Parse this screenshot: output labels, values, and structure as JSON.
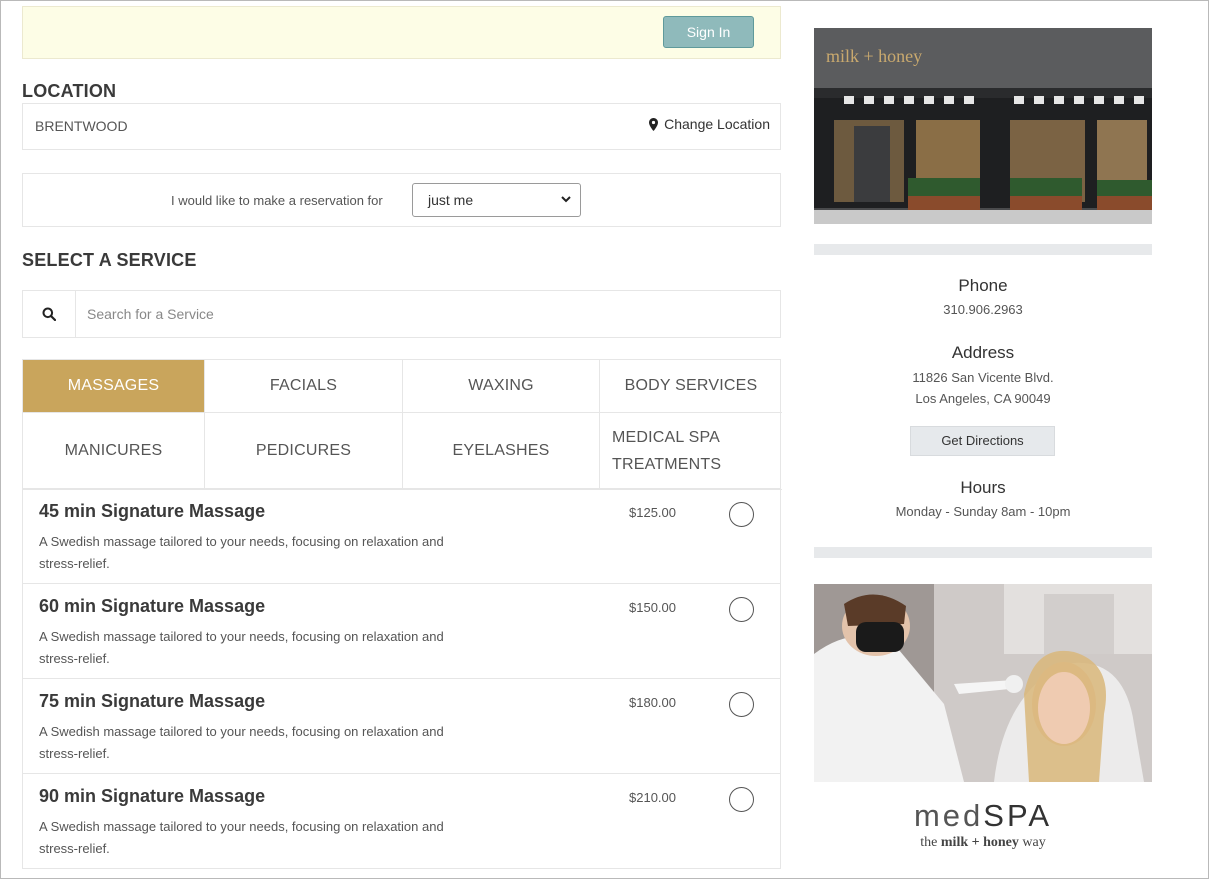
{
  "header": {
    "signin_label": "Sign In"
  },
  "location": {
    "title": "LOCATION",
    "name": "BRENTWOOD",
    "change_label": "Change Location"
  },
  "reservation": {
    "label": "I would like to make a reservation for",
    "selected": "just me"
  },
  "service": {
    "title": "SELECT A SERVICE",
    "search_placeholder": "Search for a Service"
  },
  "tabs": [
    {
      "label": "MASSAGES",
      "active": true
    },
    {
      "label": "FACIALS"
    },
    {
      "label": "WAXING"
    },
    {
      "label": "BODY SERVICES"
    },
    {
      "label": "MANICURES"
    },
    {
      "label": "PEDICURES"
    },
    {
      "label": "EYELASHES"
    },
    {
      "label": "MEDICAL SPA TREATMENTS",
      "line1": "MEDICAL SPA",
      "line2": "TREATMENTS"
    }
  ],
  "services": [
    {
      "name": "45 min Signature Massage",
      "desc": "A Swedish massage tailored to your needs, focusing on relaxation and stress-relief.",
      "price": "$125.00"
    },
    {
      "name": "60 min Signature Massage",
      "desc": "A Swedish massage tailored to your needs, focusing on relaxation and stress-relief.",
      "price": "$150.00"
    },
    {
      "name": "75 min Signature Massage",
      "desc": "A Swedish massage tailored to your needs, focusing on relaxation and stress-relief.",
      "price": "$180.00"
    },
    {
      "name": "90 min Signature Massage",
      "desc": "A Swedish massage tailored to your needs, focusing on relaxation and stress-relief.",
      "price": "$210.00"
    }
  ],
  "sidebar": {
    "storefront_sign": "milk + honey",
    "phone_heading": "Phone",
    "phone": "310.906.2963",
    "address_heading": "Address",
    "address_line1": "11826 San Vicente Blvd.",
    "address_line2": "Los Angeles, CA 90049",
    "directions_label": "Get Directions",
    "hours_heading": "Hours",
    "hours": "Monday - Sunday 8am - 10pm",
    "medspa_light": "med",
    "medspa_bold": "SPA",
    "medspa_tag_pre": "the ",
    "medspa_tag_brand": "milk + honey",
    "medspa_tag_post": " way"
  },
  "colors": {
    "accent_gold": "#c9a55c",
    "signin_teal": "#8fbabb",
    "banner_yellow": "#fdfde6"
  }
}
